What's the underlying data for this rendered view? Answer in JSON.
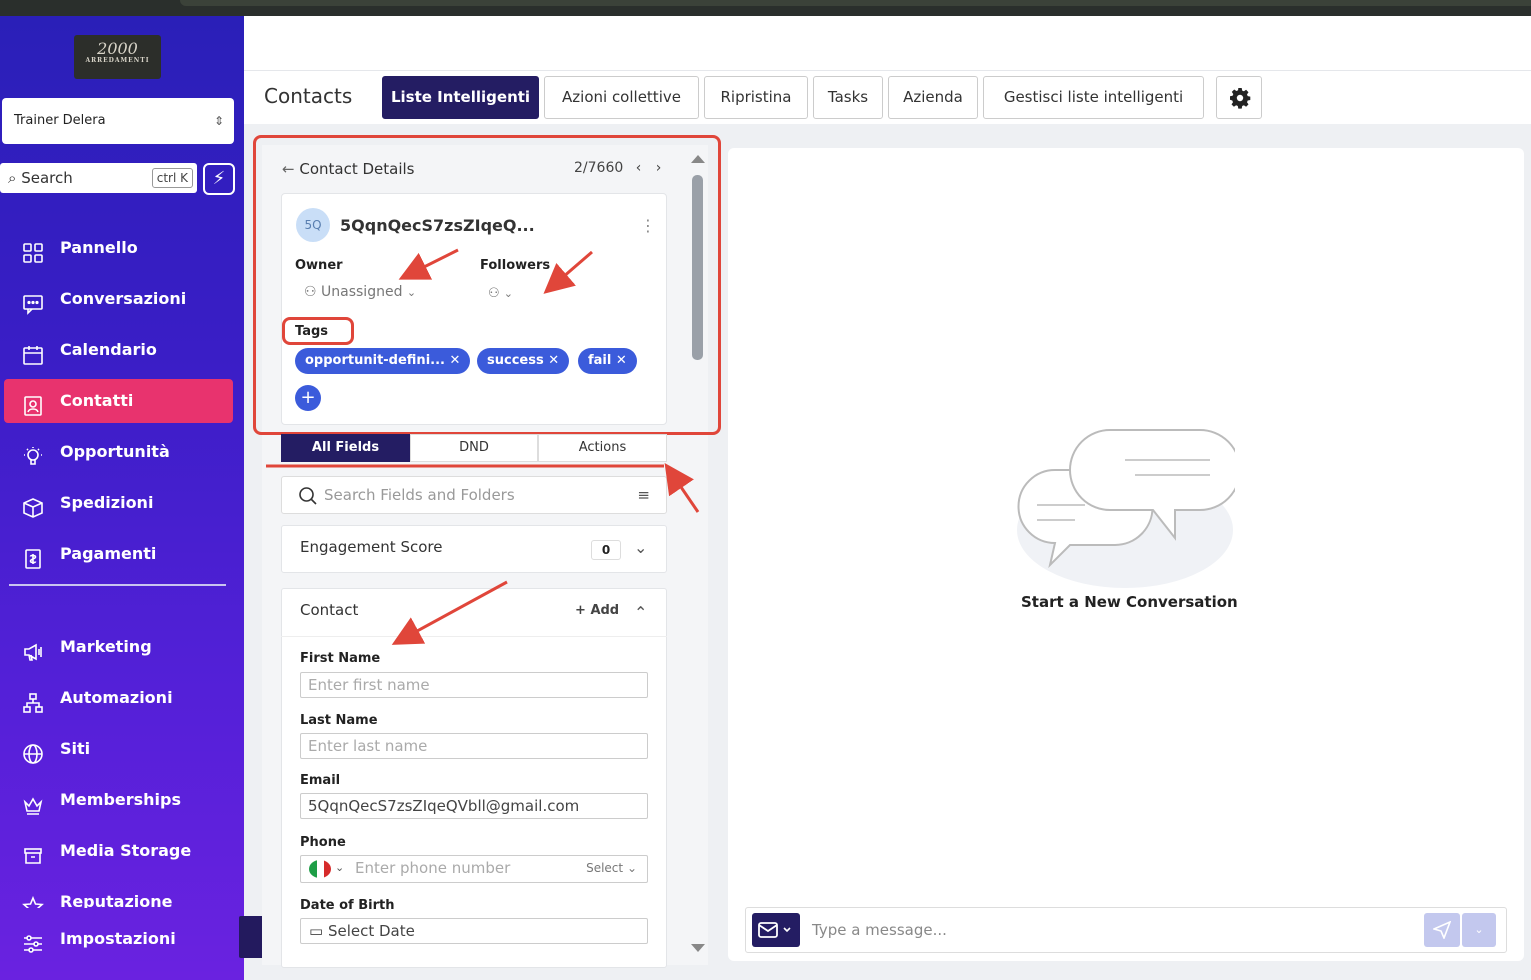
{
  "brand": {
    "logo_script": "2000",
    "logo_text": "ARREDAMENTI"
  },
  "account": {
    "name": "Trainer Delera",
    "chevron": "⌃⌄"
  },
  "search": {
    "placeholder": "Search",
    "shortcut": "ctrl K"
  },
  "sidebar": {
    "items": [
      {
        "label": "Pannello",
        "icon": "grid-icon"
      },
      {
        "label": "Conversazioni",
        "icon": "chat-icon"
      },
      {
        "label": "Calendario",
        "icon": "calendar-icon"
      },
      {
        "label": "Contatti",
        "icon": "contact-icon",
        "active": true
      },
      {
        "label": "Opportunità",
        "icon": "opportunity-icon"
      },
      {
        "label": "Spedizioni",
        "icon": "box-icon"
      },
      {
        "label": "Pagamenti",
        "icon": "payment-icon"
      },
      {
        "label": "Marketing",
        "icon": "megaphone-icon"
      },
      {
        "label": "Automazioni",
        "icon": "workflow-icon"
      },
      {
        "label": "Siti",
        "icon": "globe-icon"
      },
      {
        "label": "Memberships",
        "icon": "crown-icon"
      },
      {
        "label": "Media Storage",
        "icon": "storage-icon"
      },
      {
        "label": "Reputazione",
        "icon": "star-icon"
      },
      {
        "label": "Impostazioni",
        "icon": "settings-icon"
      }
    ]
  },
  "header": {
    "title": "Contacts",
    "tabs": [
      {
        "label": "Liste Intelligenti",
        "active": true
      },
      {
        "label": "Azioni collettive"
      },
      {
        "label": "Ripristina"
      },
      {
        "label": "Tasks"
      },
      {
        "label": "Azienda"
      },
      {
        "label": "Gestisci liste intelligenti"
      }
    ]
  },
  "contact": {
    "back_label": "Contact Details",
    "counter": "2/7660",
    "avatar_initials": "5Q",
    "name": "5QqnQecS7zsZIqeQ...",
    "owner_label": "Owner",
    "owner_value": "Unassigned",
    "followers_label": "Followers",
    "tags_label": "Tags",
    "tags": [
      "opportunit-defini...",
      "success",
      "fail"
    ]
  },
  "field_tabs": [
    "All Fields",
    "DND",
    "Actions"
  ],
  "fields_search": {
    "placeholder": "Search Fields and Folders"
  },
  "engagement": {
    "title": "Engagement Score",
    "score": "0"
  },
  "contact_section": {
    "title": "Contact",
    "add_label": "Add",
    "first_name": {
      "label": "First Name",
      "placeholder": "Enter first name"
    },
    "last_name": {
      "label": "Last Name",
      "placeholder": "Enter last name"
    },
    "email": {
      "label": "Email",
      "value": "5QqnQecS7zsZIqeQVbll@gmail.com"
    },
    "phone": {
      "label": "Phone",
      "placeholder": "Enter phone number",
      "select": "Select"
    },
    "dob": {
      "label": "Date of Birth",
      "placeholder": "Select Date"
    }
  },
  "conversation": {
    "empty_title": "Start a New Conversation",
    "message_placeholder": "Type a message..."
  },
  "colors": {
    "accent_pink": "#e8336e",
    "primary_navy": "#241d63",
    "tag_blue": "#3b5bdb",
    "annotation_red": "#e0463a"
  }
}
